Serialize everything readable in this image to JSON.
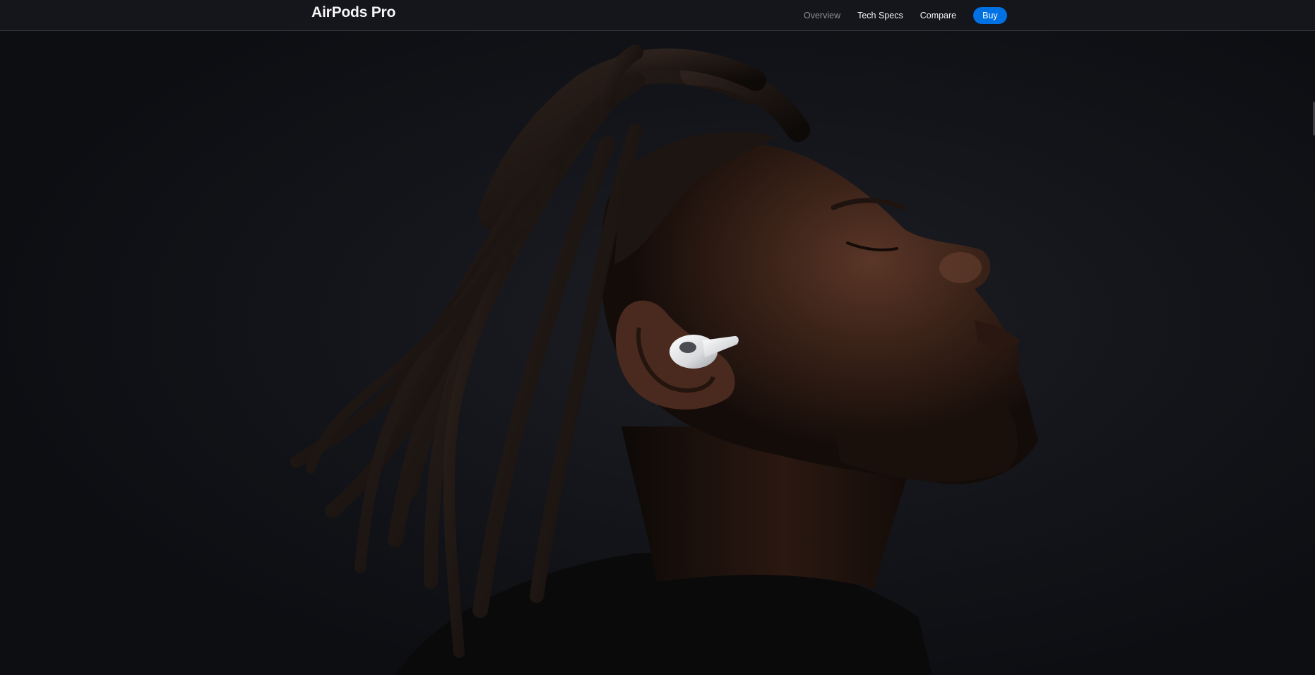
{
  "localnav": {
    "title": "AirPods Pro",
    "menu": [
      {
        "label": "Overview",
        "current": true
      },
      {
        "label": "Tech Specs",
        "current": false
      },
      {
        "label": "Compare",
        "current": false
      }
    ],
    "buy_label": "Buy"
  },
  "hero": {
    "image": "person-profile-wearing-airpods-pro-photo",
    "colors": {
      "background": "#0f1115",
      "skin": "#3a2218",
      "hair": "#201612",
      "earbud": "#e8e9ec",
      "accent": "#0071e3"
    }
  }
}
